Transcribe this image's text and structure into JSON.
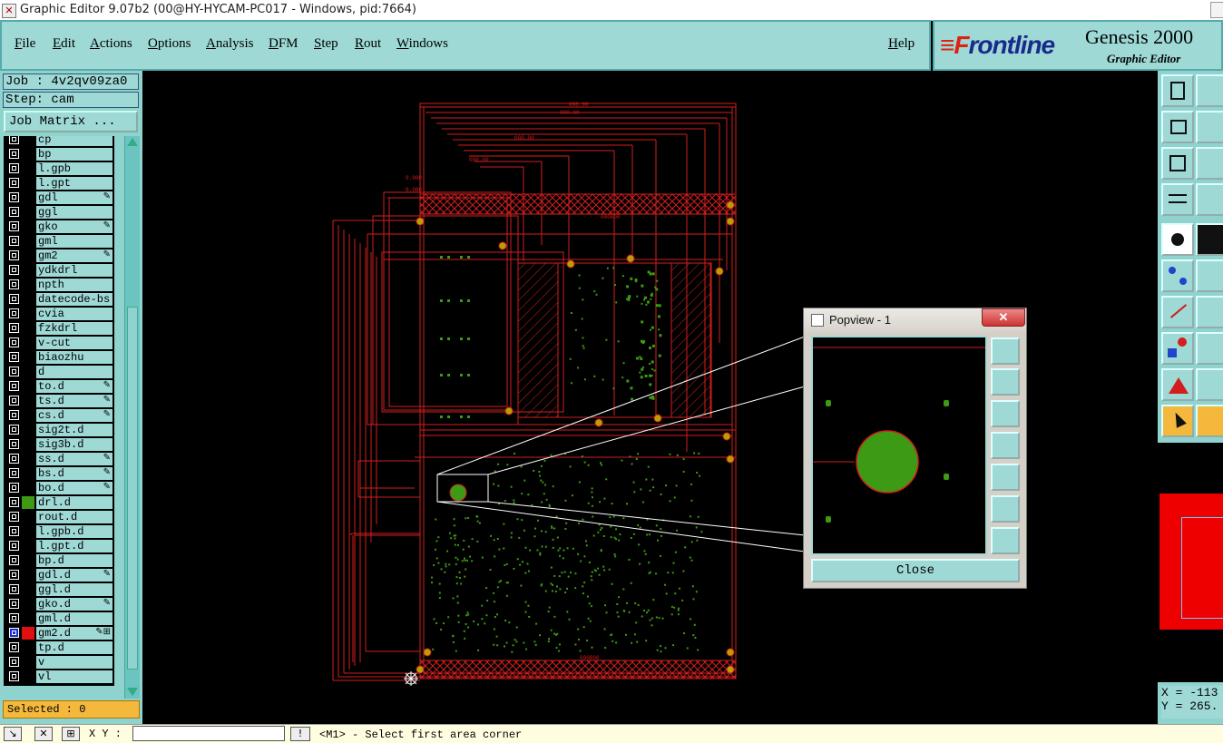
{
  "window": {
    "title": "Graphic Editor 9.07b2 (00@HY-HYCAM-PC017 - Windows, pid:7664)"
  },
  "menu": [
    "File",
    "Edit",
    "Actions",
    "Options",
    "Analysis",
    "DFM",
    "Step",
    "Rout",
    "Windows"
  ],
  "help_label": "Help",
  "brand": {
    "logo_prefix": "≡F",
    "logo_rest": "rontline",
    "product": "Genesis 2000",
    "subtitle": "Graphic Editor"
  },
  "job": {
    "job_label": "Job : 4v2qv09za0",
    "step_label": "Step: cam",
    "matrix_button": "Job Matrix ..."
  },
  "layers": [
    {
      "name": "cp",
      "flag": ""
    },
    {
      "name": "bp",
      "flag": ""
    },
    {
      "name": "l.gpb",
      "flag": ""
    },
    {
      "name": "l.gpt",
      "flag": ""
    },
    {
      "name": "gdl",
      "flag": "✎"
    },
    {
      "name": "ggl",
      "flag": ""
    },
    {
      "name": "gko",
      "flag": "✎"
    },
    {
      "name": "gml",
      "flag": ""
    },
    {
      "name": "gm2",
      "flag": "✎"
    },
    {
      "name": "ydkdrl",
      "flag": ""
    },
    {
      "name": "npth",
      "flag": ""
    },
    {
      "name": "datecode-bs",
      "flag": ""
    },
    {
      "name": "cvia",
      "flag": ""
    },
    {
      "name": "fzkdrl",
      "flag": ""
    },
    {
      "name": "v-cut",
      "flag": ""
    },
    {
      "name": "biaozhu",
      "flag": ""
    },
    {
      "name": "d",
      "flag": ""
    },
    {
      "name": "to.d",
      "flag": "✎"
    },
    {
      "name": "ts.d",
      "flag": "✎"
    },
    {
      "name": "cs.d",
      "flag": "✎"
    },
    {
      "name": "sig2t.d",
      "flag": ""
    },
    {
      "name": "sig3b.d",
      "flag": ""
    },
    {
      "name": "ss.d",
      "flag": "✎"
    },
    {
      "name": "bs.d",
      "flag": "✎"
    },
    {
      "name": "bo.d",
      "flag": "✎"
    },
    {
      "name": "drl.d",
      "flag": "",
      "state": "green"
    },
    {
      "name": "rout.d",
      "flag": ""
    },
    {
      "name": "l.gpb.d",
      "flag": ""
    },
    {
      "name": "l.gpt.d",
      "flag": ""
    },
    {
      "name": "bp.d",
      "flag": ""
    },
    {
      "name": "gdl.d",
      "flag": "✎"
    },
    {
      "name": "ggl.d",
      "flag": ""
    },
    {
      "name": "gko.d",
      "flag": "✎"
    },
    {
      "name": "gml.d",
      "flag": ""
    },
    {
      "name": "gm2.d",
      "flag": "✎⊞",
      "state": "red"
    },
    {
      "name": "tp.d",
      "flag": ""
    },
    {
      "name": "v",
      "flag": ""
    },
    {
      "name": "vl",
      "flag": ""
    }
  ],
  "selected": "Selected : 0",
  "status": {
    "xy_label": "X Y :",
    "xy_value": "",
    "prompt": "<M1> - Select first area corner"
  },
  "coords": {
    "x": "X = -113",
    "y": "Y = 265."
  },
  "popview": {
    "title": "Popview - 1",
    "close_label": "Close"
  },
  "colors": {
    "panel": "#9ed9d6",
    "board_outline": "#d21e1e",
    "drill_green": "#3c9a14",
    "accent_orange": "#f4b83c"
  }
}
